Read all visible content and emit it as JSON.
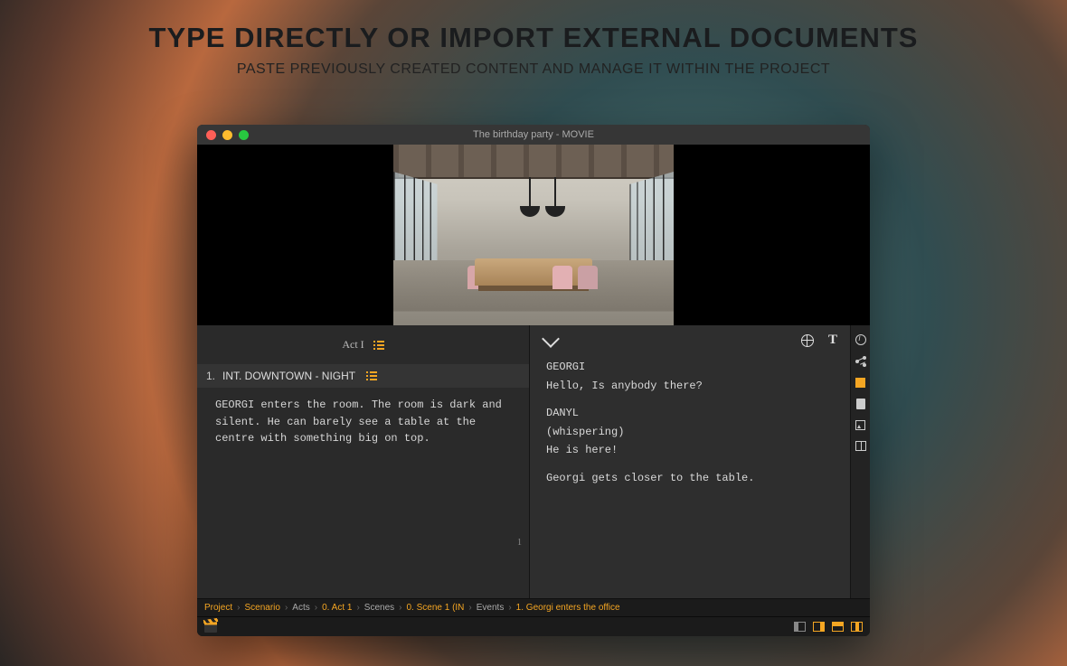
{
  "marketing": {
    "headline": "TYPE DIRECTLY OR IMPORT EXTERNAL DOCUMENTS",
    "subhead": "PASTE PREVIOUSLY CREATED CONTENT AND MANAGE IT WITHIN THE PROJECT"
  },
  "window": {
    "title": "The birthday party - MOVIE"
  },
  "left": {
    "act_label": "Act I",
    "scene_num": "1.",
    "scene_heading": "INT. DOWNTOWN - NIGHT",
    "scene_body": "GEORGI enters the room. The room is dark and silent. He can barely see a table at the centre with something big on top.",
    "page_num": "1"
  },
  "right": {
    "lines": {
      "c1": "GEORGI",
      "d1": "Hello, Is anybody there?",
      "c2": "DANYL",
      "p2": "(whispering)",
      "d2": "He is here!",
      "a1": "Georgi gets closer to the table."
    },
    "text_icon": "T"
  },
  "breadcrumb": {
    "i0": "Project",
    "i1": "Scenario",
    "i2": "Acts",
    "i3": "0. Act 1",
    "i4": "Scenes",
    "i5": "0. Scene 1 (IN",
    "i6": "Events",
    "i7": "1. Georgi enters the office",
    "sep": "›"
  }
}
